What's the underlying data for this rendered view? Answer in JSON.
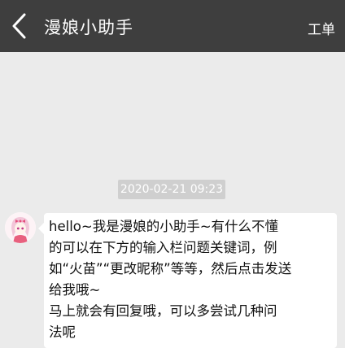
{
  "header": {
    "title": "漫娘小助手",
    "ticket_label": "工单",
    "back_icon": "chevron-left-icon"
  },
  "chat": {
    "timestamp": "2020-02-21 09:23",
    "message": {
      "lines": [
        "hello~我是漫娘的小助手~有什么不懂",
        "的可以在下方的输入栏问题关键词，例",
        "如“火苗”“更改昵称”等等，然后点击发送",
        "给我哦~",
        "马上就会有回复哦，可以多尝试几种问",
        "法呢"
      ]
    }
  },
  "colors": {
    "header_bg": "#3e3e3e",
    "chat_bg": "#ebebeb",
    "bubble_bg": "#ffffff",
    "timestamp_bg": "#cfcfcf"
  }
}
